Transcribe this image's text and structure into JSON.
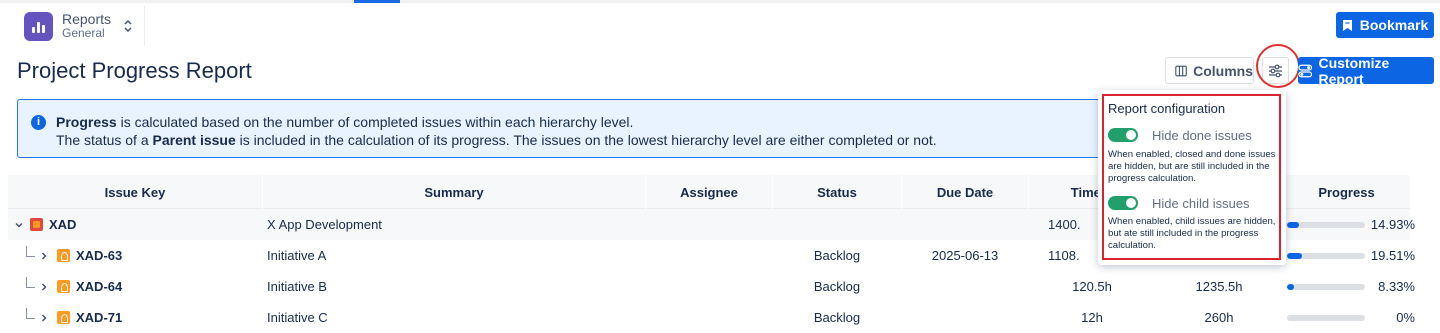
{
  "app": {
    "name": "Reports",
    "subtitle": "General"
  },
  "header": {
    "bookmark_label": "Bookmark"
  },
  "page": {
    "title": "Project Progress Report"
  },
  "toolbar": {
    "columns_label": "Columns",
    "customize_label": "Customize Report"
  },
  "info": {
    "line1_bold": "Progress",
    "line1_rest": " is calculated based on the number of completed issues within each hierarchy level.",
    "line2_pre": "The status of a ",
    "line2_bold": "Parent issue",
    "line2_rest": " is included in the calculation of its progress. The issues on the lowest hierarchy level are either completed or not."
  },
  "table": {
    "columns": [
      "Issue Key",
      "Summary",
      "Assignee",
      "Status",
      "Due Date",
      "Time S",
      "",
      "Progress"
    ],
    "rows": [
      {
        "key": "XAD",
        "summary": "X App Development",
        "assignee": "",
        "status": "",
        "due_date": "",
        "time_spent": "1400.",
        "estimate": "",
        "progress_pct": "14.93%",
        "progress": 0.1493,
        "expanded": true
      },
      {
        "key": "XAD-63",
        "summary": "Initiative A",
        "assignee": "",
        "status": "Backlog",
        "due_date": "2025-06-13",
        "time_spent": "1108.",
        "estimate": "",
        "progress_pct": "19.51%",
        "progress": 0.1951
      },
      {
        "key": "XAD-64",
        "summary": "Initiative B",
        "assignee": "",
        "status": "Backlog",
        "due_date": "",
        "time_spent": "120.5h",
        "estimate": "1235.5h",
        "progress_pct": "8.33%",
        "progress": 0.0833
      },
      {
        "key": "XAD-71",
        "summary": "Initiative C",
        "assignee": "",
        "status": "Backlog",
        "due_date": "",
        "time_spent": "12h",
        "estimate": "260h",
        "progress_pct": "0%",
        "progress": 0
      }
    ]
  },
  "config_popup": {
    "title": "Report configuration",
    "hide_done": {
      "label": "Hide done issues",
      "enabled": true,
      "help": "When enabled, closed and done issues are hidden, but are still included in the progress calculation."
    },
    "hide_child": {
      "label": "Hide child issues",
      "enabled": true,
      "help": "When enabled, child issues are hidden, but ate still included in the progress calculation."
    }
  },
  "icons": {
    "app_logo": "bar-chart-icon",
    "bookmark": "bookmark-icon",
    "columns": "columns-icon",
    "config": "sliders-icon",
    "customize": "toggles-icon",
    "info": "info-icon",
    "epic": "epic-icon",
    "initiative": "initiative-icon"
  },
  "colors": {
    "primary": "#0c66e4",
    "highlight": "#e23030",
    "toggle_on": "#22a06b",
    "app_logo": "#6554c0"
  }
}
